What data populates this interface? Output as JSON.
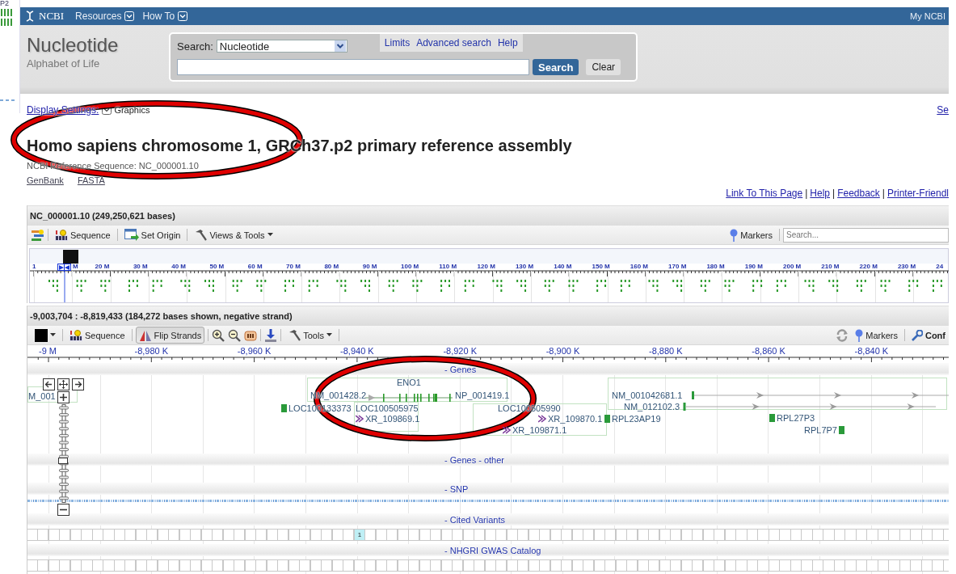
{
  "background_window": {
    "label": "P2"
  },
  "top_bar": {
    "logo": "NCBI",
    "menus": [
      "Resources",
      "How To"
    ],
    "account": "My NCBI"
  },
  "header": {
    "database": "Nucleotide",
    "tagline": "Alphabet of Life",
    "search_label": "Search:",
    "database_select": "Nucleotide",
    "links": [
      "Limits",
      "Advanced search",
      "Help"
    ],
    "buttons": [
      "Search",
      "Clear"
    ]
  },
  "display_settings": {
    "link": "Display Settings:",
    "value": "Graphics",
    "right_link": "Se"
  },
  "title": "Homo sapiens chromosome 1, GRCh37.p2 primary reference assembly",
  "reference": "NCBI Reference Sequence: NC_000001.10",
  "format_links": [
    "GenBank",
    "FASTA"
  ],
  "page_links": [
    {
      "label": "Link To This Page"
    },
    {
      "separator": "|",
      "label": "Help"
    },
    {
      "separator": "|",
      "label": "Feedback"
    },
    {
      "separator": "|",
      "label": "Printer-Friendl"
    }
  ],
  "overview": {
    "title": "NC_000001.10 (249,250,621 bases)",
    "tools": [
      "Sequence",
      "Set Origin",
      "Views & Tools"
    ],
    "markers": "Markers",
    "search": {
      "placeholder": "Search..."
    },
    "ticks": [
      "1",
      "M",
      "20 M",
      "30 M",
      "40 M",
      "50 M",
      "60 M",
      "70 M",
      "80 M",
      "90 M",
      "100 M",
      "110 M",
      "120 M",
      "130 M",
      "140 M",
      "150 M",
      "160 M",
      "170 M",
      "180 M",
      "190 M",
      "200 M",
      "210 M",
      "220 M",
      "230 M",
      "24"
    ]
  },
  "detail": {
    "title": "-9,003,704 : -8,819,433 (184,272 bases shown, negative strand)",
    "tools": [
      {
        "label": "Sequence",
        "selected": false
      },
      {
        "label": "Flip Strands",
        "selected": true
      },
      {
        "label": "Tools",
        "selected": false
      }
    ],
    "markers": "Markers",
    "configure": "Conf",
    "ticks": [
      "-9 M",
      "-8,980 K",
      "-8,960 K",
      "-8,940 K",
      "-8,920 K",
      "-8,900 K",
      "-8,880 K",
      "-8,860 K",
      "-8,840 K"
    ],
    "tracks": [
      {
        "kind": "genes",
        "title": "- Genes",
        "features": [
          {
            "kind": "label",
            "text": "M_001"
          },
          {
            "kind": "label",
            "text": "ENO1"
          },
          {
            "kind": "label",
            "text": "NM_001428.2"
          },
          {
            "kind": "exons"
          },
          {
            "kind": "label",
            "text": "NP_001419.1"
          },
          {
            "kind": "pseudogene",
            "text": "LOC100133373"
          },
          {
            "kind": "label",
            "text": "LOC100505975"
          },
          {
            "kind": "ncrna",
            "text": "XR_109869.1"
          },
          {
            "kind": "label",
            "text": "LOC100505990"
          },
          {
            "kind": "ncrna",
            "text": "XR_109870.1"
          },
          {
            "kind": "ncrna",
            "text": "XR_109871.1"
          },
          {
            "kind": "transcript",
            "text": "NM_001042681.1"
          },
          {
            "kind": "transcript",
            "text": "NM_012102.3"
          },
          {
            "kind": "pseudogene",
            "text": "RPL23AP19"
          },
          {
            "kind": "pseudogene",
            "text": "RPL27P3"
          },
          {
            "kind": "trailing",
            "text": "RPL7P7"
          }
        ]
      },
      {
        "kind": "empty",
        "title": "- Genes - other"
      },
      {
        "kind": "snp",
        "title": "- SNP"
      },
      {
        "kind": "bins",
        "title": "- Cited Variants",
        "counts": [
          {
            "label": "1"
          }
        ]
      },
      {
        "kind": "bins",
        "title": "- NHGRI GWAS Catalog"
      }
    ]
  },
  "annotations": [
    {
      "kind": "ellipse"
    },
    {
      "kind": "ellipse"
    }
  ]
}
